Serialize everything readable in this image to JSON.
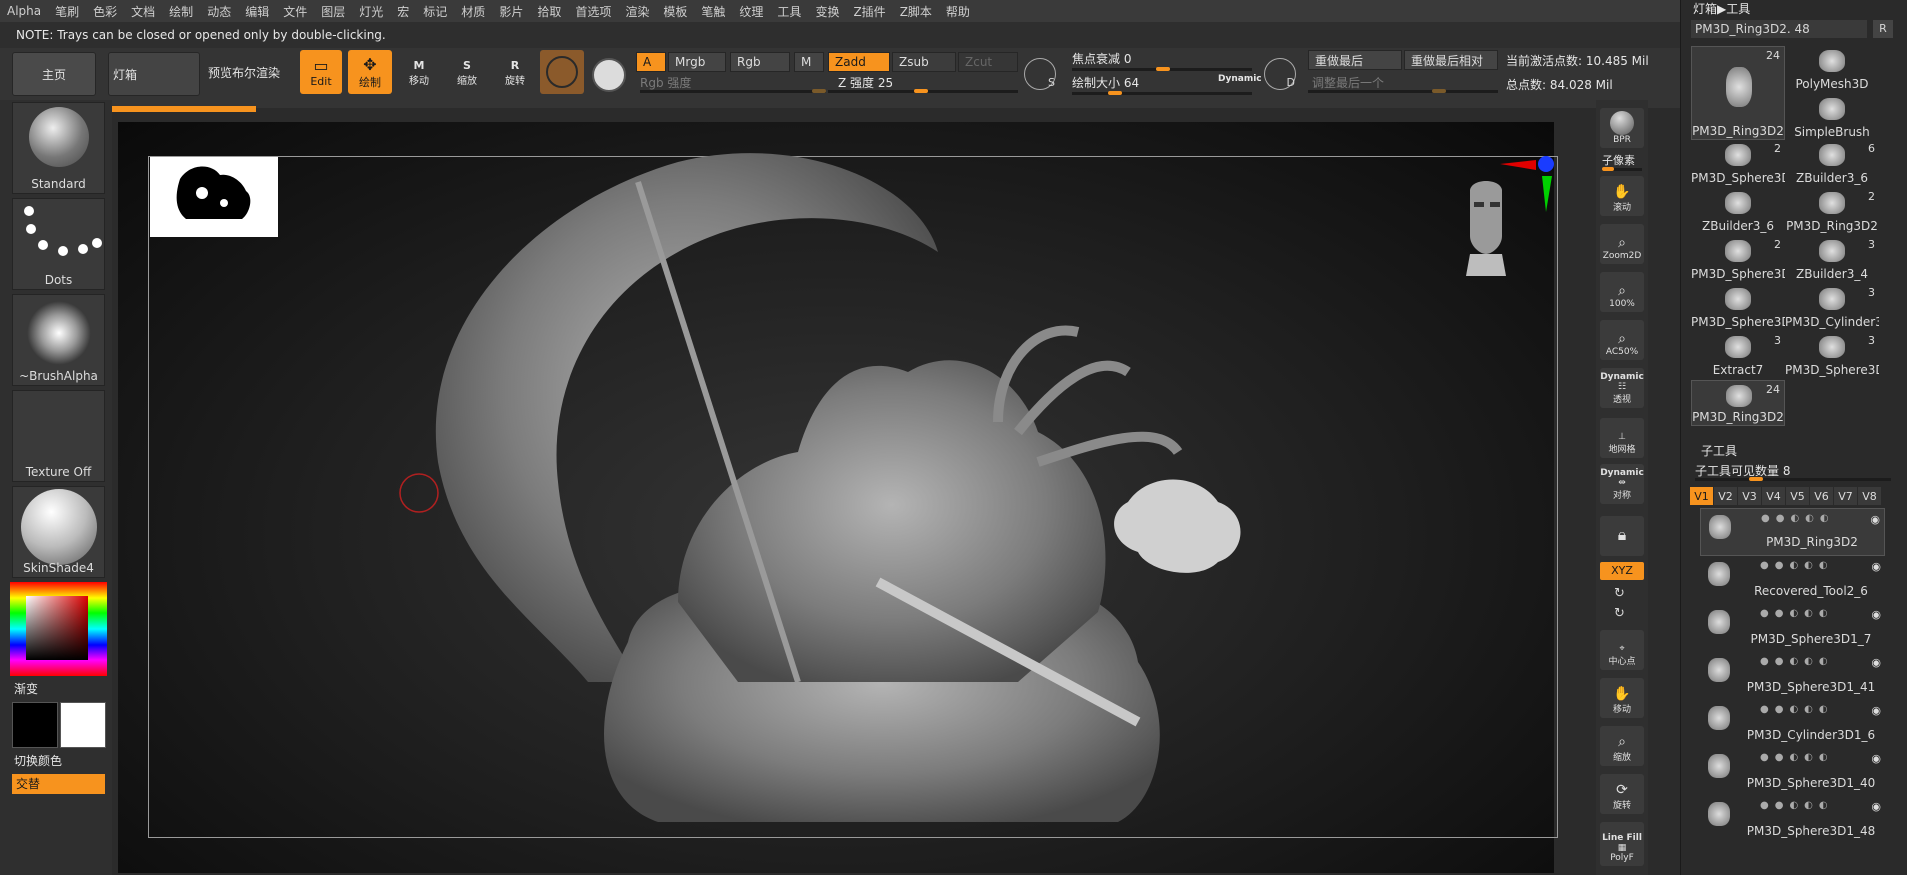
{
  "menu": [
    "Alpha",
    "笔刷",
    "色彩",
    "文档",
    "绘制",
    "动态",
    "编辑",
    "文件",
    "图层",
    "灯光",
    "宏",
    "标记",
    "材质",
    "影片",
    "拾取",
    "首选项",
    "渲染",
    "模板",
    "笔触",
    "纹理",
    "工具",
    "变换",
    "Z插件",
    "Z脚本",
    "帮助"
  ],
  "note": "NOTE: Trays can be closed or opened only by double-clicking.",
  "shelf": {
    "home": "主页",
    "lightbox": "灯箱",
    "preview_render": "预览布尔渲染",
    "edit": "Edit",
    "draw": "绘制",
    "move": "移动",
    "scale": "缩放",
    "rotate": "旋转",
    "move_key": "M",
    "scale_key": "S",
    "rotate_key": "R",
    "a": "A",
    "mrgb": "Mrgb",
    "rgb": "Rgb",
    "m": "M",
    "rgb_intensity": "Rgb 强度",
    "zadd": "Zadd",
    "zsub": "Zsub",
    "zcut": "Zcut",
    "z_intensity": "Z 强度 25",
    "s": "S",
    "focal_shift": "焦点衰减 0",
    "draw_size": "绘制大小 64",
    "dynamic": "Dynamic",
    "d": "D",
    "redo_last": "重做最后",
    "redo_last_rel": "重做最后相对",
    "adjust_last": "调整最后一个",
    "active_points": "当前激活点数: 10.485 Mil",
    "total_points": "总点数: 84.028 Mil"
  },
  "left_tray": {
    "brush": "Standard",
    "stroke": "Dots",
    "alpha": "~BrushAlpha",
    "texture": "Texture Off",
    "material": "SkinShade4",
    "gradient": "渐变",
    "switch_color": "切换颜色",
    "alternate": "交替",
    "primary_color": "#000000",
    "secondary_color": "#ffffff"
  },
  "right_shelf": {
    "bpr": "BPR",
    "subpixel": "子像素",
    "scroll": "滚动",
    "zoom2d": "Zoom2D",
    "p100": "100%",
    "ac50": "AC50%",
    "dynamic1": "Dynamic",
    "perspective": "透视",
    "floor": "地网格",
    "dynamic2": "Dynamic",
    "symmetry": "对称",
    "xyz": "XYZ",
    "center": "中心点",
    "move": "移动",
    "zoom": "缩放",
    "rotate": "旋转",
    "linefill": "Line Fill",
    "polyf": "PolyF"
  },
  "right_panel": {
    "header": "灯箱▶工具",
    "current_tool": "PM3D_Ring3D2. 48",
    "r": "R",
    "tools": [
      {
        "name": "PM3D_Ring3D2",
        "count": "24"
      },
      {
        "name": "PolyMesh3D",
        "count": ""
      },
      {
        "name": "SimpleBrush",
        "count": ""
      },
      {
        "name": "PM3D_Sphere3D",
        "count": "2"
      },
      {
        "name": "ZBuilder3_6",
        "count": "6"
      },
      {
        "name": "ZBuilder3_6",
        "count": ""
      },
      {
        "name": "PM3D_Ring3D2",
        "count": "2"
      },
      {
        "name": "PM3D_Sphere3D",
        "count": "2"
      },
      {
        "name": "ZBuilder3_4",
        "count": "3"
      },
      {
        "name": "PM3D_Sphere3D",
        "count": ""
      },
      {
        "name": "PM3D_Cylinder3",
        "count": "3"
      },
      {
        "name": "Extract7",
        "count": "3"
      },
      {
        "name": "PM3D_Sphere3D",
        "count": "3"
      },
      {
        "name": "PM3D_Ring3D2",
        "count": "24"
      }
    ],
    "subtool_header": "子工具",
    "subtool_count": "子工具可见数量 8",
    "versions": [
      "V1",
      "V2",
      "V3",
      "V4",
      "V5",
      "V6",
      "V7",
      "V8"
    ],
    "subtools": [
      "PM3D_Ring3D2",
      "Recovered_Tool2_6",
      "PM3D_Sphere3D1_7",
      "PM3D_Sphere3D1_41",
      "PM3D_Cylinder3D1_6",
      "PM3D_Sphere3D1_40",
      "PM3D_Sphere3D1_48"
    ]
  }
}
